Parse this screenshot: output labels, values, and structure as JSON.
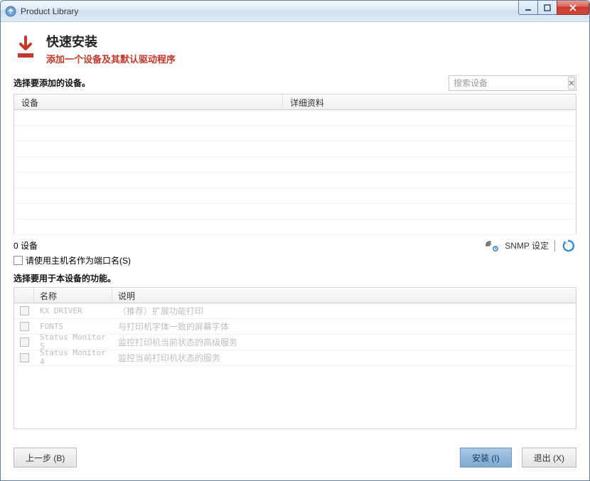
{
  "window": {
    "title": "Product Library"
  },
  "header": {
    "title": "快速安装",
    "subtitle": "添加一个设备及其默认驱动程序"
  },
  "section1": {
    "label": "选择要添加的设备。",
    "search_placeholder": "搜索设备",
    "columns": {
      "c1": "设备",
      "c2": "详细资料"
    }
  },
  "status": {
    "count_text": "0 设备",
    "hostname_checkbox": "请使用主机名作为端口名(S)",
    "snmp_label": "SNMP 设定"
  },
  "section2": {
    "label": "选择要用于本设备的功能。",
    "columns": {
      "c1": "名称",
      "c2": "说明"
    },
    "rows": [
      {
        "name": "KX DRIVER",
        "desc": "（推荐）扩展功能打印"
      },
      {
        "name": "FONTS",
        "desc": "与打印机字体一致的屏幕字体"
      },
      {
        "name": "Status Monitor 5",
        "desc": "监控打印机当前状态的高级服务"
      },
      {
        "name": "Status Monitor 4",
        "desc": "监控当前打印机状态的服务"
      }
    ]
  },
  "buttons": {
    "back": "上一步 (B)",
    "install": "安装 (I)",
    "exit": "退出 (X)"
  }
}
